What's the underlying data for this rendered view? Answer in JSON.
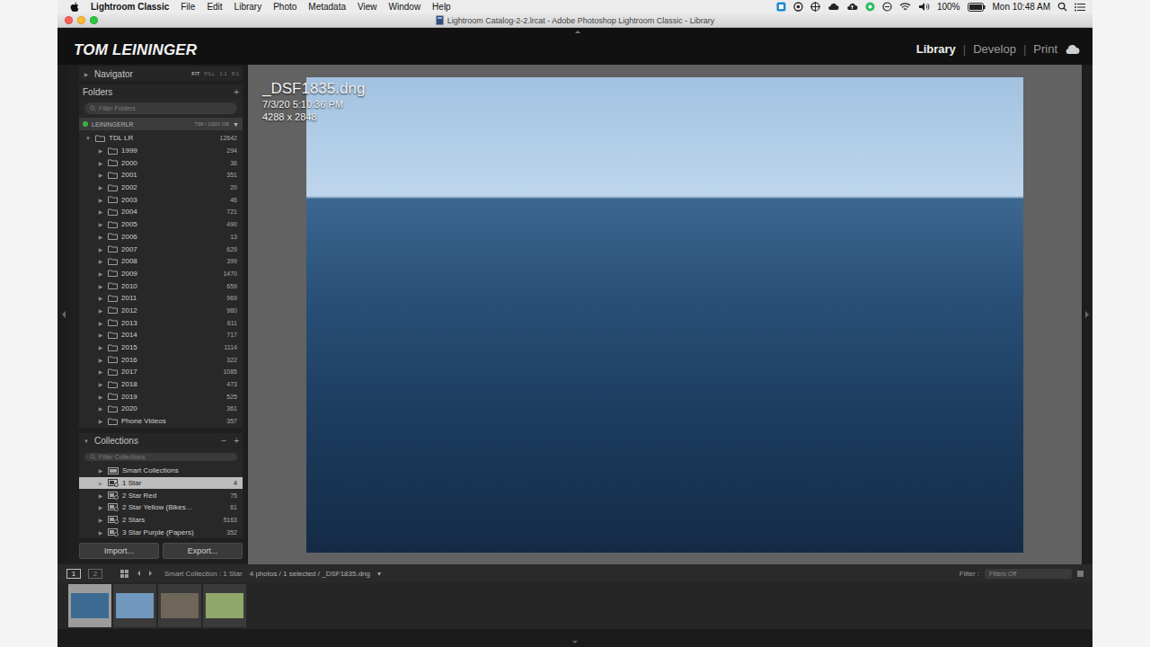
{
  "menubar": {
    "app_name": "Lightroom Classic",
    "menus": [
      "File",
      "Edit",
      "Library",
      "Photo",
      "Metadata",
      "View",
      "Window",
      "Help"
    ],
    "battery": "100%",
    "clock": "Mon 10:48 AM"
  },
  "window": {
    "title": "Lightroom Catalog-2-2.lrcat - Adobe Photoshop Lightroom Classic - Library"
  },
  "identity_plate": {
    "name": "TOM LEININGER"
  },
  "module_picker": {
    "separator": "|",
    "modules": [
      {
        "label": "Library",
        "selected": true
      },
      {
        "label": "Develop",
        "selected": false
      },
      {
        "label": "Print",
        "selected": false
      }
    ]
  },
  "tree_arrows": {
    "collapsed": "▶",
    "expanded": "▼"
  },
  "navigator": {
    "title": "Navigator",
    "expanded": false,
    "zoom_levels": [
      {
        "label": "FIT",
        "selected": true
      },
      {
        "label": "FILL",
        "selected": false
      },
      {
        "label": "1:1",
        "selected": false
      },
      {
        "label": "8:1",
        "selected": false
      }
    ]
  },
  "folders": {
    "title": "Folders",
    "add": "+",
    "filter_placeholder": "Filter Folders",
    "volume": {
      "name": "LEININGERLR",
      "space": "758 / 1000 GB",
      "expanded": true,
      "online": true
    },
    "root": {
      "name": "TDL LR",
      "count": "12642",
      "expanded": true
    },
    "items": [
      {
        "name": "1999",
        "count": "294",
        "expanded": false
      },
      {
        "name": "2000",
        "count": "36",
        "expanded": false
      },
      {
        "name": "2001",
        "count": "351",
        "expanded": false
      },
      {
        "name": "2002",
        "count": "20",
        "expanded": false
      },
      {
        "name": "2003",
        "count": "46",
        "expanded": false
      },
      {
        "name": "2004",
        "count": "721",
        "expanded": false
      },
      {
        "name": "2005",
        "count": "490",
        "expanded": false
      },
      {
        "name": "2006",
        "count": "13",
        "expanded": false
      },
      {
        "name": "2007",
        "count": "629",
        "expanded": false
      },
      {
        "name": "2008",
        "count": "399",
        "expanded": false
      },
      {
        "name": "2009",
        "count": "1470",
        "expanded": false
      },
      {
        "name": "2010",
        "count": "659",
        "expanded": false
      },
      {
        "name": "2011",
        "count": "969",
        "expanded": false
      },
      {
        "name": "2012",
        "count": "980",
        "expanded": false
      },
      {
        "name": "2013",
        "count": "611",
        "expanded": false
      },
      {
        "name": "2014",
        "count": "717",
        "expanded": false
      },
      {
        "name": "2015",
        "count": "1114",
        "expanded": false
      },
      {
        "name": "2016",
        "count": "322",
        "expanded": false
      },
      {
        "name": "2017",
        "count": "1085",
        "expanded": false
      },
      {
        "name": "2018",
        "count": "473",
        "expanded": false
      },
      {
        "name": "2019",
        "count": "525",
        "expanded": false
      },
      {
        "name": "2020",
        "count": "361",
        "expanded": false
      },
      {
        "name": "Phone Videos",
        "count": "357",
        "expanded": false
      }
    ]
  },
  "collections": {
    "title": "Collections",
    "remove": "−",
    "add": "+",
    "filter_placeholder": "Filter Collections",
    "items": [
      {
        "name": "Smart Collections",
        "kind": "set",
        "selected": false,
        "expanded": false
      },
      {
        "name": "1 Star",
        "count": "4",
        "kind": "smart",
        "selected": true,
        "expanded": false
      },
      {
        "name": "2 Star Red",
        "count": "75",
        "kind": "smart",
        "selected": false,
        "expanded": false
      },
      {
        "name": "2 Star Yellow (Bikes…",
        "count": "61",
        "kind": "smart",
        "selected": false,
        "expanded": false
      },
      {
        "name": "2 Stars",
        "count": "5163",
        "kind": "smart",
        "selected": false,
        "expanded": false
      },
      {
        "name": "3 Star Purple (Papers)",
        "count": "352",
        "kind": "smart",
        "selected": false,
        "expanded": false
      }
    ]
  },
  "panel_buttons": [
    "Import...",
    "Export..."
  ],
  "loupe_info": {
    "filename": "_DSF1835.dng",
    "captured": "7/3/20 5:10:36 PM",
    "dimensions": "4288 x 2848"
  },
  "filmstrip_bar": {
    "views": [
      {
        "label": "1",
        "selected": true
      },
      {
        "label": "2",
        "selected": false
      }
    ],
    "source": "Smart Collection : 1 Star",
    "status": "4 photos / 1 selected / _DSF1835.dng",
    "status_menu": "▾",
    "filter_label": "Filter :",
    "filter_value": "Filters Off"
  },
  "filmstrip": [
    {
      "selected": true,
      "color": "#3d6a93"
    },
    {
      "selected": false,
      "color": "#7098be"
    },
    {
      "selected": false,
      "color": "#6e6659"
    },
    {
      "selected": false,
      "color": "#8fa86a"
    }
  ]
}
